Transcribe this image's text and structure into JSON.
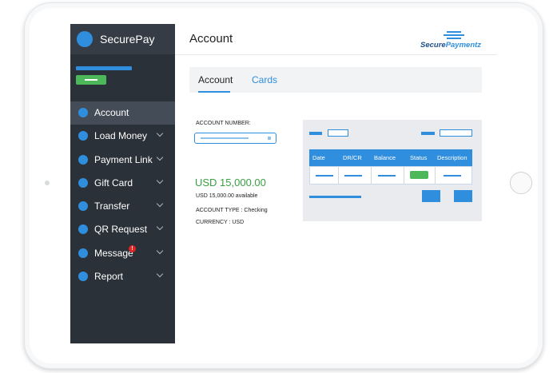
{
  "app": {
    "name": "SecurePay"
  },
  "header": {
    "title": "Account",
    "logo_text_a": "Secure",
    "logo_text_b": "Paymentz"
  },
  "tabs": [
    {
      "label": "Account"
    },
    {
      "label": "Cards"
    }
  ],
  "sidebar": {
    "items": [
      {
        "label": "Account",
        "active": true
      },
      {
        "label": "Load Money"
      },
      {
        "label": "Payment Link"
      },
      {
        "label": "Gift Card"
      },
      {
        "label": "Transfer"
      },
      {
        "label": "QR Request"
      },
      {
        "label": "Message",
        "badge": "!"
      },
      {
        "label": "Report"
      }
    ]
  },
  "account": {
    "number_label": "ACCOUNT NUMBER:",
    "balance": "USD 15,000.00",
    "available": "USD 15,000.00 available",
    "type": "ACCOUNT TYPE : Checking",
    "currency": "CURRENCY : USD"
  },
  "table": {
    "columns": [
      "Date",
      "DR/CR",
      "Balance",
      "Status",
      "Description"
    ]
  },
  "colors": {
    "accent": "#2f8fde",
    "sidebar": "#2b3138",
    "success": "#4cb85a",
    "amount": "#3aa043",
    "badge": "#e02424"
  }
}
